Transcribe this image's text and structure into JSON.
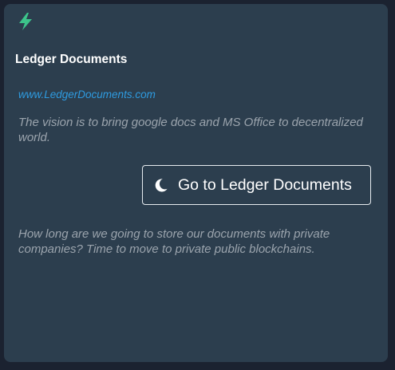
{
  "card": {
    "icon": "lightning-bolt-icon",
    "title": "Ledger Documents",
    "link": "www.LedgerDocuments.com",
    "description": "The vision is to bring google docs and MS Office to decentralized world.",
    "button": {
      "icon": "moon-icon",
      "label": "Go to Ledger Documents"
    },
    "note": "How long are we going to store our documents with private companies? Time to move to private public blockchains."
  },
  "colors": {
    "page_background": "#1b2230",
    "card_background": "#2c3e4e",
    "accent_green": "#3cc48a",
    "link_blue": "#2e9be0",
    "muted_text": "#9ba4ad"
  }
}
